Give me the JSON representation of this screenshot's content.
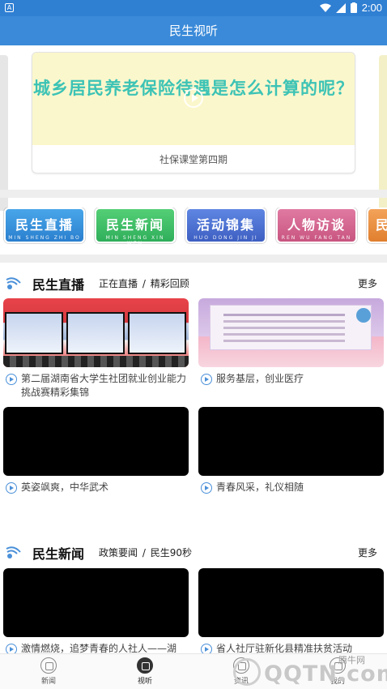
{
  "status_bar": {
    "time": "2:00",
    "app_icon": "A"
  },
  "header": {
    "title": "民生视听"
  },
  "banner": {
    "headline": "城乡居民养老保险待遇是怎么计算的呢？",
    "caption": "社保课堂第四期"
  },
  "categories": [
    {
      "label": "民生直播",
      "pinyin": "MIN SHENG ZHI BO"
    },
    {
      "label": "民生新闻",
      "pinyin": "MIN SHENG XIN WEN"
    },
    {
      "label": "活动锦集",
      "pinyin": "HUO DONG JIN JI"
    },
    {
      "label": "人物访谈",
      "pinyin": "REN WU FANG TAN"
    },
    {
      "label": "民",
      "pinyin": ""
    }
  ],
  "live_section": {
    "title": "民生直播",
    "tab1": "正在直播",
    "sep": "/",
    "tab2": "精彩回顾",
    "more": "更多",
    "videos": [
      {
        "caption": "第二届湖南省大学生社团就业创业能力挑战赛精彩集锦"
      },
      {
        "caption": "服务基层，创业医疗"
      },
      {
        "caption": "英姿飒爽，中华武术"
      },
      {
        "caption": "青春风采，礼仪相随"
      }
    ]
  },
  "news_section": {
    "title": "民生新闻",
    "tab1": "政策要闻",
    "sep": "/",
    "tab2": "民生90秒",
    "more": "更多",
    "videos": [
      {
        "caption": "激情燃烧，追梦青春的人社人——湖"
      },
      {
        "caption": "省人社厅驻新化县精准扶贫活动"
      }
    ]
  },
  "bottom_nav": [
    {
      "label": "新闻"
    },
    {
      "label": "视听"
    },
    {
      "label": "资讯"
    },
    {
      "label": "我的"
    }
  ],
  "watermark": {
    "text": "QQTN.com",
    "small": "腾牛网"
  },
  "colors": {
    "primary": "#3a8ad9",
    "status": "#2f7fd3",
    "accent_teal": "#3cc3b5"
  }
}
